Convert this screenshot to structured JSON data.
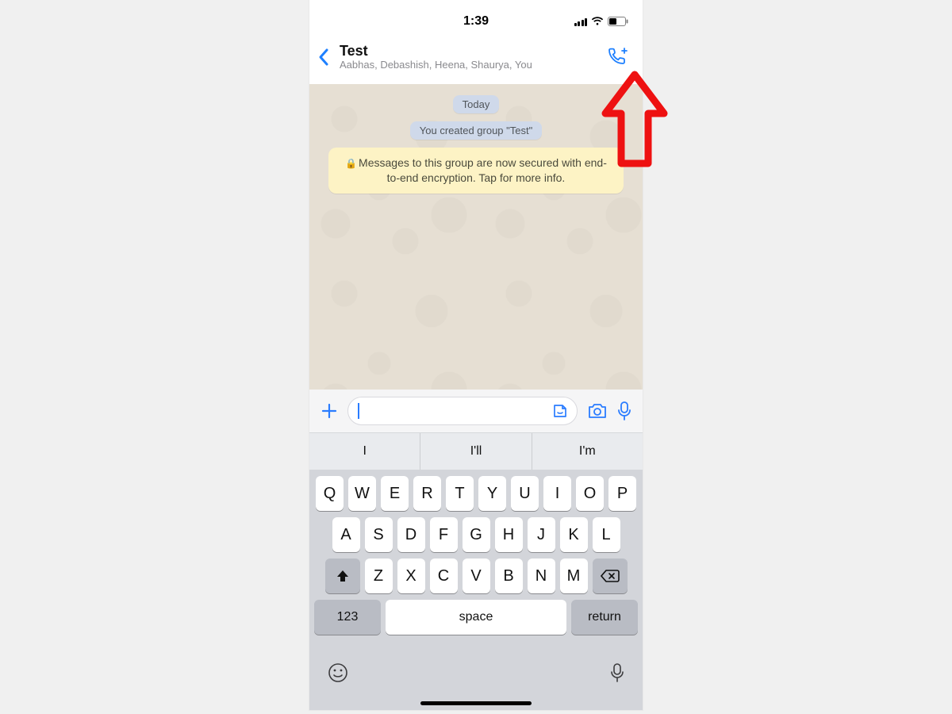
{
  "status": {
    "time": "1:39"
  },
  "header": {
    "title": "Test",
    "subtitle": "Aabhas, Debashish, Heena, Shaurya, You"
  },
  "chat": {
    "date_chip": "Today",
    "system_message": "You created group \"Test\"",
    "encryption_notice": "Messages to this group are now secured with end-to-end encryption. Tap for more info."
  },
  "input": {
    "value": ""
  },
  "keyboard": {
    "suggestions": [
      "I",
      "I'll",
      "I'm"
    ],
    "rows": [
      [
        "Q",
        "W",
        "E",
        "R",
        "T",
        "Y",
        "U",
        "I",
        "O",
        "P"
      ],
      [
        "A",
        "S",
        "D",
        "F",
        "G",
        "H",
        "J",
        "K",
        "L"
      ],
      [
        "Z",
        "X",
        "C",
        "V",
        "B",
        "N",
        "M"
      ]
    ],
    "numeric_label": "123",
    "space_label": "space",
    "return_label": "return"
  }
}
